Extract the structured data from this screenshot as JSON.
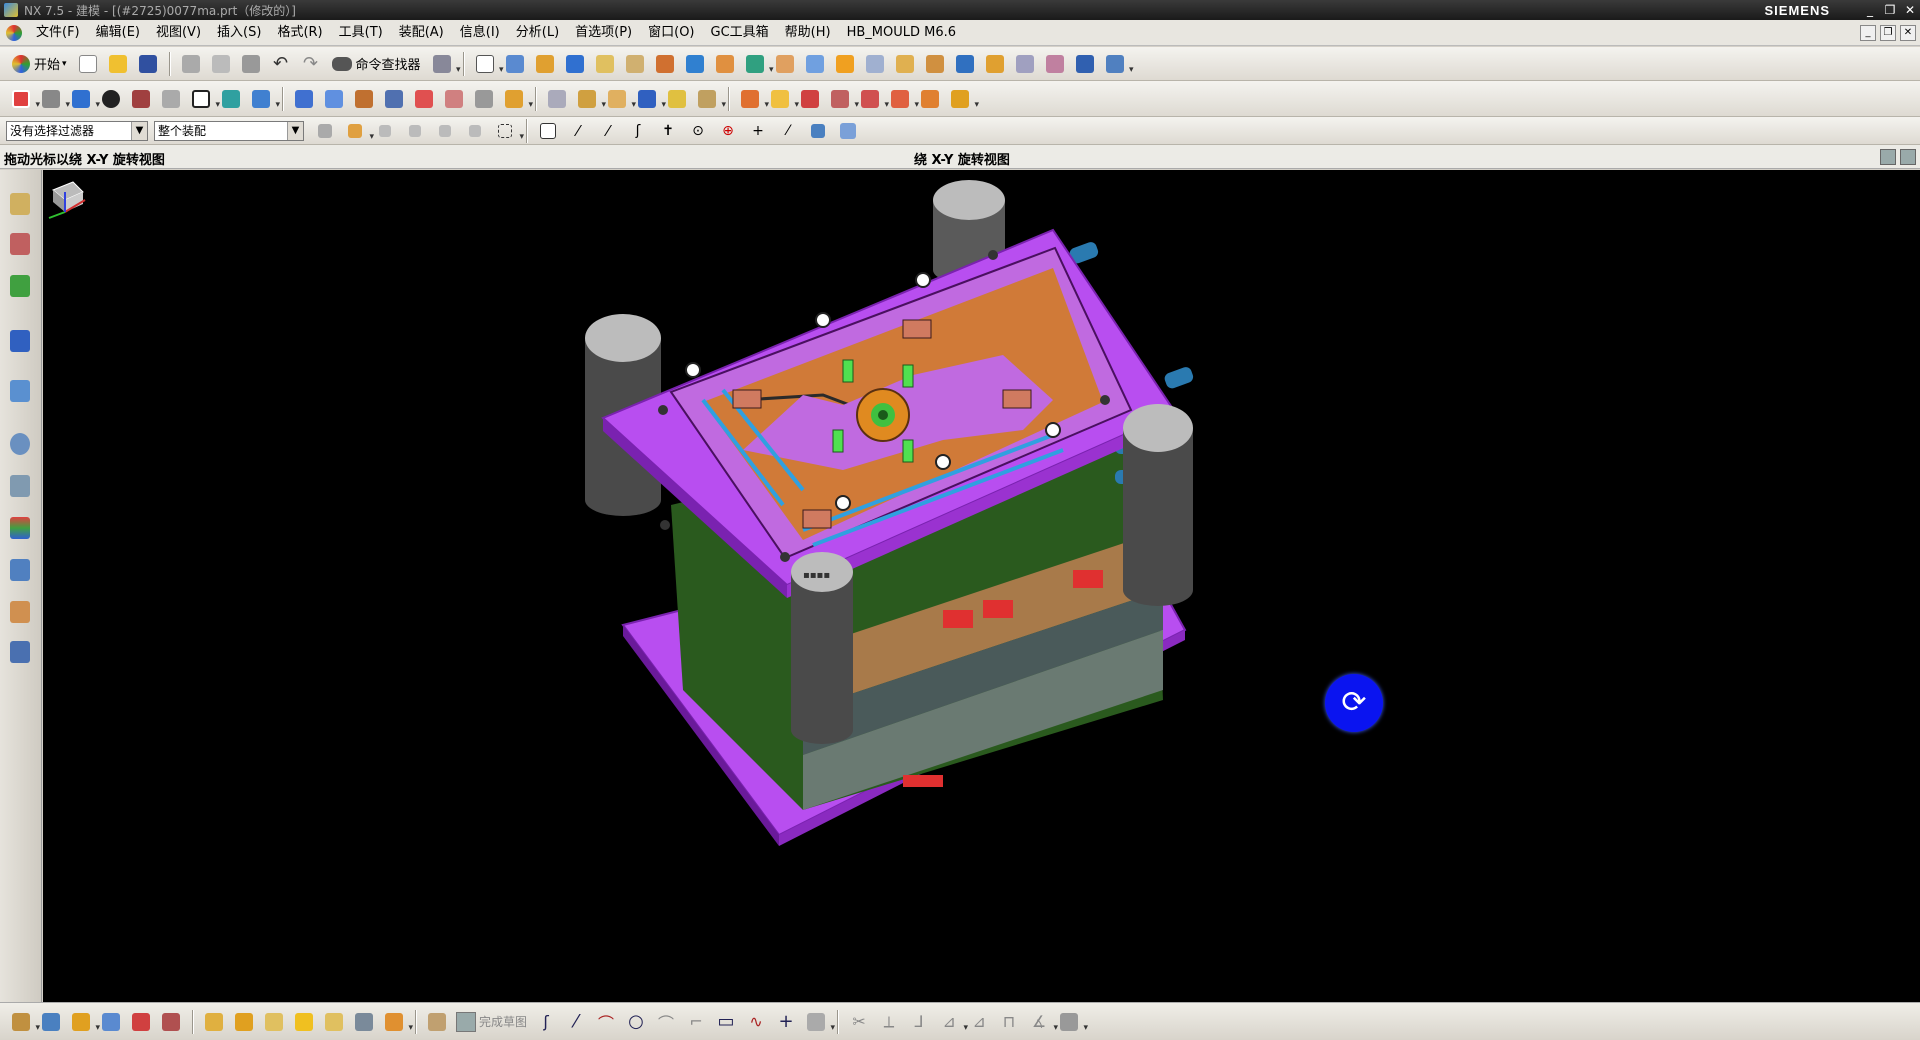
{
  "window": {
    "title": "NX 7.5 - 建模 - [(#2725)0077ma.prt（修改的）]",
    "brand": "SIEMENS",
    "controls": [
      "_",
      "❐",
      "✕"
    ]
  },
  "menu": {
    "items": [
      "文件(F)",
      "编辑(E)",
      "视图(V)",
      "插入(S)",
      "格式(R)",
      "工具(T)",
      "装配(A)",
      "信息(I)",
      "分析(L)",
      "首选项(P)",
      "窗口(O)",
      "GC工具箱",
      "帮助(H)",
      "HB_MOULD M6.6"
    ]
  },
  "toolbar1": {
    "start_label": "开始",
    "command_finder_label": "命令查找器"
  },
  "selection": {
    "type_filter": "没有选择过滤器",
    "scope": "整个装配"
  },
  "cue_line": {
    "cue": "拖动光标以绕 X-Y 旋转视图",
    "status": "绕 X-Y 旋转视图"
  },
  "bottom_toolbar": {
    "finish_sketch_label": "完成草图"
  },
  "colors": {
    "plate": "#b84ef0",
    "plate_edge": "#7a22b0",
    "pillar": "#bcbcbc",
    "viewport_bg": "#000000",
    "spin_indicator": "#0a14f0"
  },
  "icons": {
    "spin": "rotate-icon",
    "triad": "wcs-triad-icon"
  }
}
